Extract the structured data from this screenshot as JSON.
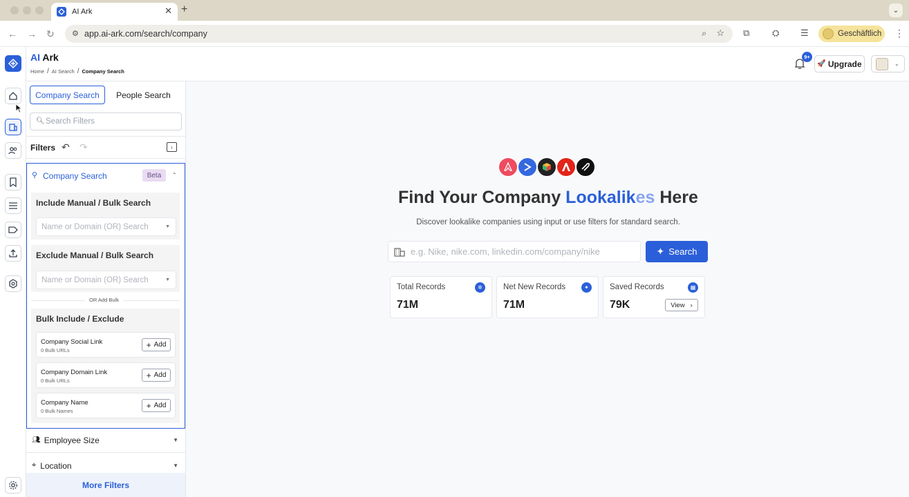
{
  "browser": {
    "tab_title": "AI Ark",
    "url": "app.ai-ark.com/search/company",
    "profile_label": "Geschäftlich"
  },
  "header": {
    "brand_ai": "AI",
    "brand_rest": " Ark",
    "breadcrumbs": [
      "Home",
      "AI Search",
      "Company Search"
    ],
    "notifications_badge": "9+",
    "upgrade_label": "Upgrade"
  },
  "sidebar": {
    "tabs": [
      {
        "label": "Company Search",
        "active": true
      },
      {
        "label": "People Search",
        "active": false
      }
    ],
    "search_placeholder": "Search Filters",
    "filters_label": "Filters",
    "company_search": {
      "title": "Company Search",
      "badge": "Beta",
      "include": {
        "title": "Include Manual / Bulk Search",
        "placeholder": "Name or Domain (OR) Search"
      },
      "exclude": {
        "title": "Exclude Manual / Bulk Search",
        "placeholder": "Name or Domain (OR) Search"
      },
      "or_label": "OR Add Bulk",
      "bulk": {
        "title": "Bulk Include / Exclude",
        "items": [
          {
            "title": "Company Social Link",
            "sub": "0 Bulk URLs",
            "action": "Add"
          },
          {
            "title": "Company Domain Link",
            "sub": "0 Bulk URLs",
            "action": "Add"
          },
          {
            "title": "Company Name",
            "sub": "0 Bulk Names",
            "action": "Add"
          }
        ]
      }
    },
    "accordions": [
      {
        "label": "Employee Size"
      },
      {
        "label": "Location"
      }
    ],
    "more_filters": "More Filters"
  },
  "main": {
    "headline_start": "Find Your Company ",
    "headline_hl": "Lookalik",
    "headline_hl2": "es",
    "headline_end": " Here",
    "subline": "Discover lookalike companies using input or use filters for standard search.",
    "search_placeholder": "e.g. Nike, nike.com, linkedin.com/company/nike",
    "search_button": "Search",
    "cards": [
      {
        "title": "Total Records",
        "value": "71M"
      },
      {
        "title": "Net New Records",
        "value": "71M"
      },
      {
        "title": "Saved Records",
        "value": "79K",
        "action": "View"
      }
    ]
  },
  "colors": {
    "accent": "#2b5fd9",
    "beta_bg": "#e9dcf2"
  }
}
